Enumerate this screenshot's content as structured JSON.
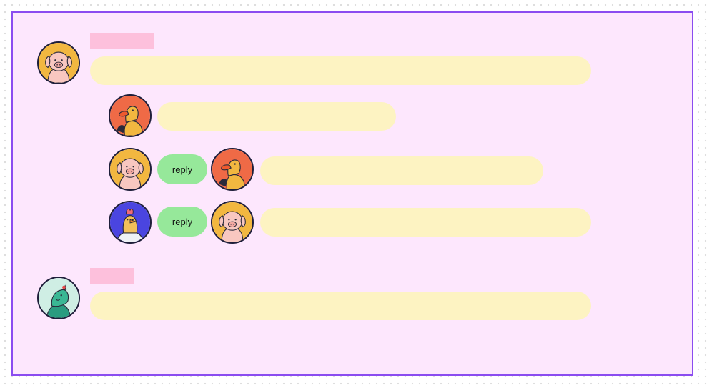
{
  "thread": {
    "reply_label": "reply",
    "avatars": {
      "pig": "pig-avatar",
      "duck": "duck-avatar",
      "chicken": "chicken-avatar",
      "dragon": "dragon-avatar"
    }
  },
  "colors": {
    "frame_border": "#8b4cf0",
    "frame_bg": "#fde7fd",
    "name_bar": "#fdc0dc",
    "bubble": "#fdf3c2",
    "reply_button": "#96e89a"
  }
}
